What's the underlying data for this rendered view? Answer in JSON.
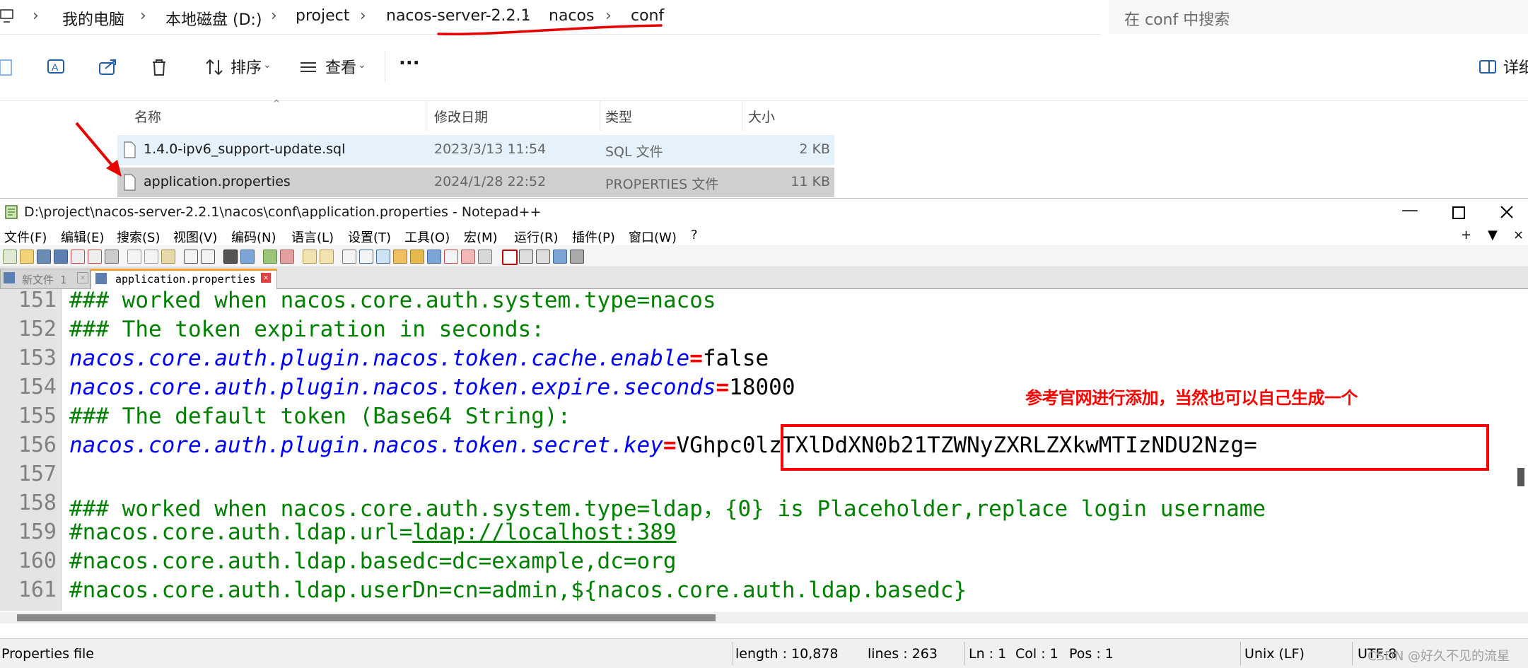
{
  "explorer": {
    "breadcrumbs": [
      "我的电脑",
      "本地磁盘 (D:)",
      "project",
      "nacos-server-2.2.1",
      "nacos",
      "conf"
    ],
    "search_placeholder": "在 conf 中搜索",
    "toolbar": {
      "sort_label": "排序",
      "view_label": "查看",
      "more_label": "...",
      "details_label": "详细"
    },
    "columns": [
      "名称",
      "修改日期",
      "类型",
      "大小"
    ],
    "files": [
      {
        "name": "1.4.0-ipv6_support-update.sql",
        "modified": "2023/3/13 11:54",
        "type": "SQL 文件",
        "size": "2 KB"
      },
      {
        "name": "application.properties",
        "modified": "2024/1/28 22:52",
        "type": "PROPERTIES 文件",
        "size": "11 KB"
      }
    ]
  },
  "notepad": {
    "title": "D:\\project\\nacos-server-2.2.1\\nacos\\conf\\application.properties - Notepad++",
    "menus": [
      "文件(F)",
      "编辑(E)",
      "搜索(S)",
      "视图(V)",
      "编码(N)",
      "语言(L)",
      "设置(T)",
      "工具(O)",
      "宏(M)",
      "运行(R)",
      "插件(P)",
      "窗口(W)",
      "?"
    ],
    "menu_right": [
      "+",
      "▼",
      "×"
    ],
    "tabs": [
      "新文件 1",
      "application.properties"
    ],
    "lines": [
      {
        "num": "151",
        "comment": "### worked when nacos.core.auth.system.type=nacos"
      },
      {
        "num": "152",
        "comment": "### The token expiration in seconds:"
      },
      {
        "num": "153",
        "key": "nacos.core.auth.plugin.nacos.token.cache.enable",
        "eq": "=",
        "value": "false"
      },
      {
        "num": "154",
        "key": "nacos.core.auth.plugin.nacos.token.expire.seconds",
        "eq": "=",
        "value": "18000"
      },
      {
        "num": "155",
        "comment": "### The default token (Base64 String):"
      },
      {
        "num": "156",
        "key": "nacos.core.auth.plugin.nacos.token.secret.key",
        "eq": "=",
        "value": "VGhpc0lzTXlDdXN0b21TZWNyZXRLZXkwMTIzNDU2Nzg="
      },
      {
        "num": "157"
      },
      {
        "num": "158",
        "comment": "### worked when nacos.core.auth.system.type=ldap，{0} is Placeholder,replace login username"
      },
      {
        "num": "159",
        "comment_a": "#nacos.core.auth.ldap.url=",
        "comment_url": "ldap://localhost:389"
      },
      {
        "num": "160",
        "comment": "#nacos.core.auth.ldap.basedc=dc=example,dc=org"
      },
      {
        "num": "161",
        "comment": "#nacos.core.auth.ldap.userDn=cn=admin,${nacos.core.auth.ldap.basedc}"
      }
    ],
    "annotation": "参考官网进行添加，当然也可以自己生成一个",
    "status": {
      "filetype": "Properties file",
      "length": "length : 10,878",
      "lines": "lines : 263",
      "ln": "Ln : 1",
      "col": "Col : 1",
      "pos": "Pos : 1",
      "eol": "Unix (LF)",
      "encoding": "UTF-8",
      "watermark": "CSDN @好久不见的流星"
    },
    "colors": {
      "comment": "#008000",
      "key": "#0000ff",
      "operator": "#ff0000",
      "annotation": "#ff0000"
    }
  }
}
